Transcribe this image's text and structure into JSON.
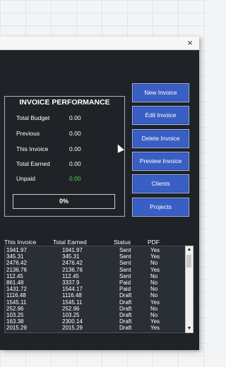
{
  "window": {
    "close_glyph": "×"
  },
  "performance": {
    "title": "INVOICE PERFORMANCE",
    "rows": [
      {
        "label": "Total Budget",
        "value": "0.00"
      },
      {
        "label": "Previous",
        "value": "0.00"
      },
      {
        "label": "This Invoice",
        "value": "0.00"
      },
      {
        "label": "Total Earned",
        "value": "0.00"
      },
      {
        "label": "Unpaid",
        "value": "0.00"
      }
    ],
    "percent": "0%",
    "unpaid_color": "#4fd24f"
  },
  "buttons": [
    {
      "label": "New Invoice"
    },
    {
      "label": "Edit Invoice"
    },
    {
      "label": "Delete Invoice"
    },
    {
      "label": "Preview Invoice"
    },
    {
      "label": "Clients"
    },
    {
      "label": "Projects"
    }
  ],
  "table": {
    "headers": [
      "This Invoice",
      "Total Earned",
      "Status",
      "PDF"
    ],
    "rows": [
      [
        "1941.97",
        "1941.97",
        "Sent",
        "Yes"
      ],
      [
        "345.31",
        "345.31",
        "Sent",
        "Yes"
      ],
      [
        "2476.42",
        "2476.42",
        "Sent",
        "No"
      ],
      [
        "2136.76",
        "2136.76",
        "Sent",
        "Yes"
      ],
      [
        "112.45",
        "112.45",
        "Sent",
        "No"
      ],
      [
        "861.48",
        "3337.9",
        "Paid",
        "No"
      ],
      [
        "1431.72",
        "1544.17",
        "Paid",
        "No"
      ],
      [
        "1116.48",
        "1116.48",
        "Draft",
        "No"
      ],
      [
        "1545.11",
        "1545.11",
        "Draft",
        "Yes"
      ],
      [
        "252.96",
        "252.96",
        "Draft",
        "No"
      ],
      [
        "103.25",
        "103.25",
        "Draft",
        "No"
      ],
      [
        "163.38",
        "2300.14",
        "Draft",
        "Yes"
      ],
      [
        "2015.29",
        "2015.29",
        "Draft",
        "Yes"
      ]
    ]
  },
  "scrollbar": {
    "up_glyph": "▲",
    "down_glyph": "▼"
  },
  "accent": "#3a5fc4"
}
